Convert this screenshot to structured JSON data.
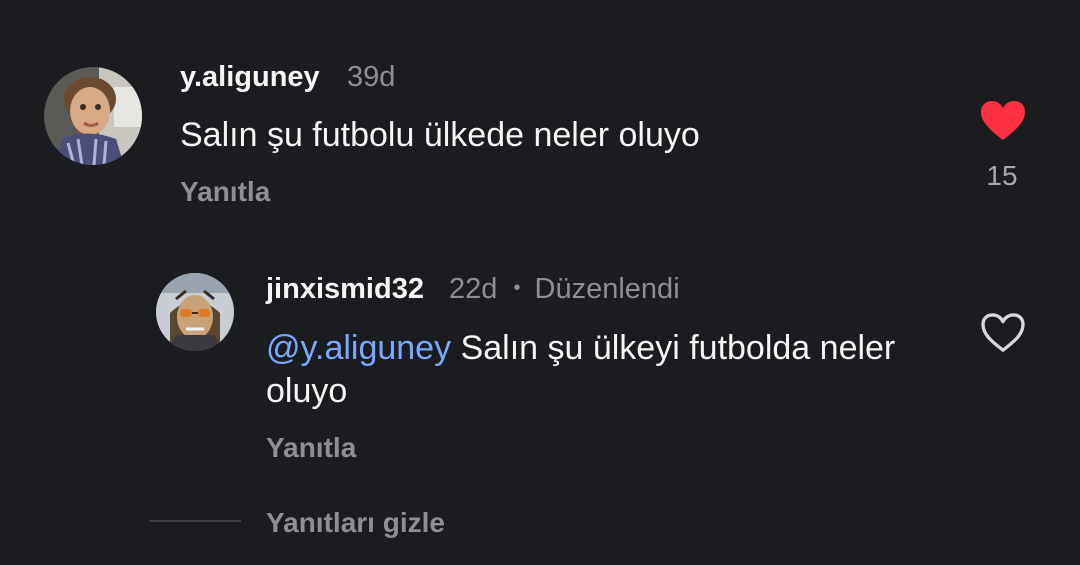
{
  "comment": {
    "username": "y.aliguney",
    "age": "39d",
    "text": "Salın şu futbolu ülkede neler oluyo",
    "reply_label": "Yanıtla",
    "like_count": "15",
    "liked": true,
    "avatar_icon": "child-photo-avatar",
    "heart_color": "#ff3040"
  },
  "reply": {
    "username": "jinxismid32",
    "age": "22d",
    "separator": "•",
    "edited_label": "Düzenlendi",
    "mention": "@y.aliguney",
    "text": "Salın şu ülkeyi futbolda neler oluyo",
    "reply_label": "Yanıtla",
    "liked": false,
    "avatar_icon": "anime-character-avatar"
  },
  "hide_replies_label": "Yanıtları gizle",
  "colors": {
    "background": "#1a1c20",
    "text_primary": "#f5f5f5",
    "text_secondary": "#8e8e93",
    "mention": "#7aa7ff"
  }
}
